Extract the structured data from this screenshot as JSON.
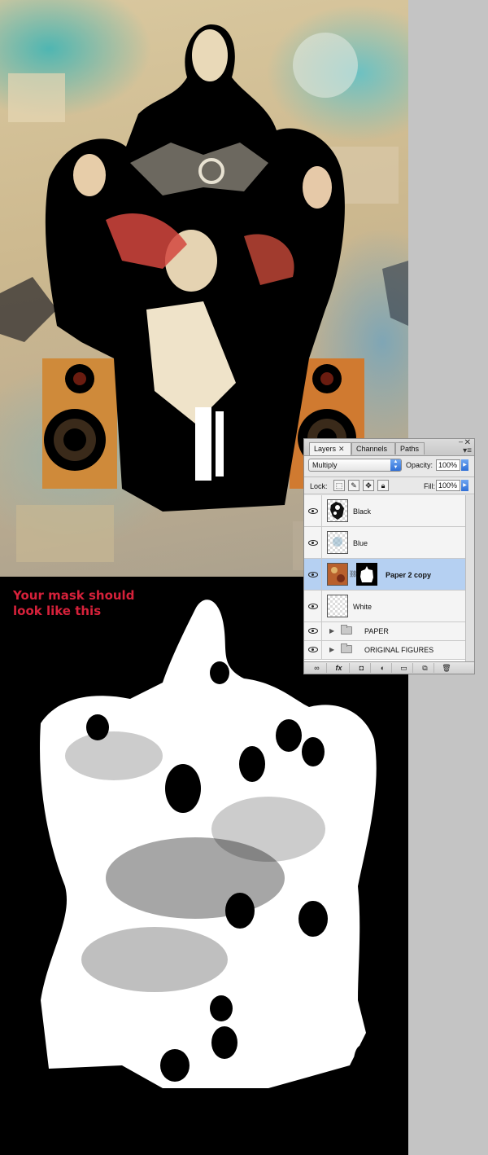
{
  "mask_caption": {
    "line1": "Your mask should",
    "line2": "look like this"
  },
  "layers_panel": {
    "tabs": [
      {
        "label": "Layers",
        "active": true
      },
      {
        "label": "Channels",
        "active": false
      },
      {
        "label": "Paths",
        "active": false
      }
    ],
    "blend_mode": "Multiply",
    "opacity_label": "Opacity:",
    "opacity_value": "100%",
    "lock_label": "Lock:",
    "fill_label": "Fill:",
    "fill_value": "100%",
    "layers": [
      {
        "name": "Black",
        "selected": false,
        "has_mask": false
      },
      {
        "name": "Blue",
        "selected": false,
        "has_mask": false
      },
      {
        "name": "Paper 2 copy",
        "selected": true,
        "has_mask": true
      },
      {
        "name": "White",
        "selected": false,
        "has_mask": false
      }
    ],
    "groups": [
      {
        "name": "PAPER"
      },
      {
        "name": "ORIGINAL FIGURES"
      }
    ],
    "icons": {
      "close": "close-icon",
      "collapse": "collapse-icon",
      "menu": "panel-menu-icon",
      "eye": "eye-icon",
      "folder": "folder-icon",
      "link": "link-icon",
      "lock": "lock-icon",
      "fx": "fx-icon",
      "trash": "trash-icon"
    },
    "bottom_bar": {
      "fx_label": "fx"
    }
  },
  "colors": {
    "caption_red": "#d6213a",
    "selected_row": "#b5d0f2",
    "mask_background": "#000000"
  }
}
